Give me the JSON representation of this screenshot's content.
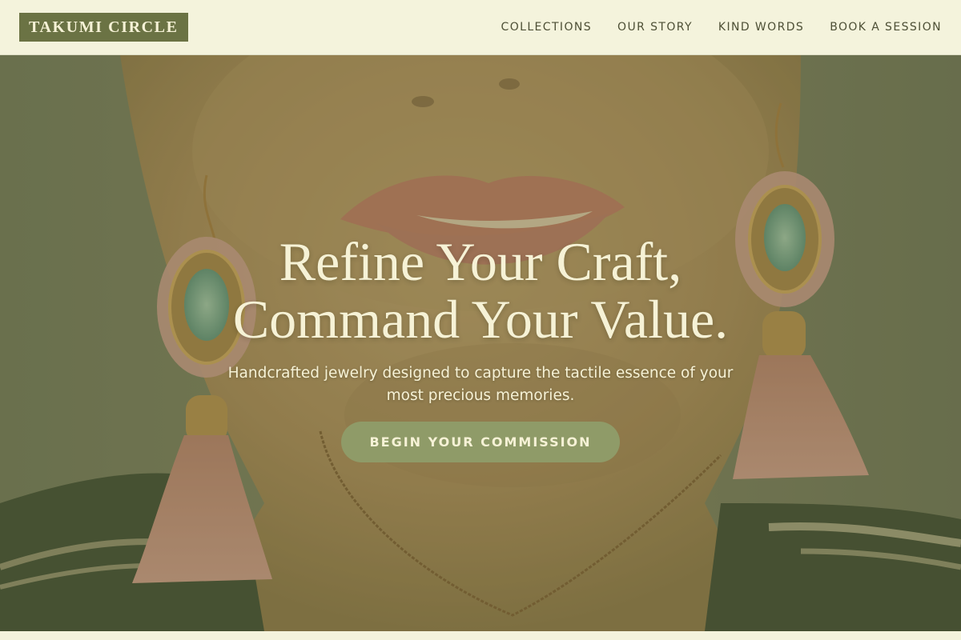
{
  "header": {
    "logo_text": "TAKUMI CIRCLE",
    "nav": [
      {
        "label": "COLLECTIONS"
      },
      {
        "label": "OUR STORY"
      },
      {
        "label": "KIND WORDS"
      },
      {
        "label": "BOOK A SESSION"
      }
    ]
  },
  "hero": {
    "headline_line1": "Refine Your Craft,",
    "headline_line2": "Command Your Value.",
    "subheadline": "Handcrafted jewelry designed to capture the tactile essence of your most precious memories.",
    "cta_label": "BEGIN YOUR COMMISSION",
    "photo_description_icon": "portrait-with-tassel-earrings-image"
  },
  "colors": {
    "background": "#f4f3dc",
    "brand": "#6b7344",
    "nav_text": "#4d4f35",
    "hero_text": "#f6f2d6",
    "cta_bg": "#8f9b68",
    "overlay": "#5c6634"
  }
}
